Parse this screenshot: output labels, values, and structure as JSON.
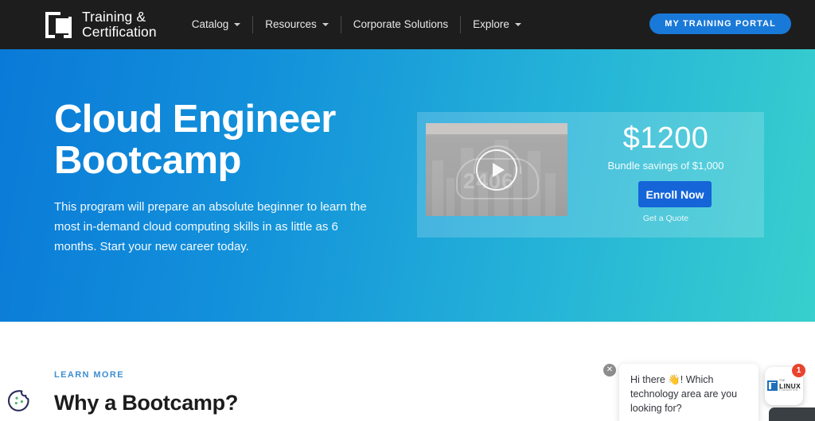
{
  "header": {
    "brand": {
      "icon": "logo-mark-icon",
      "line1": "Training &",
      "line2": "Certification"
    },
    "nav": [
      {
        "label": "Catalog",
        "has_caret": true
      },
      {
        "label": "Resources",
        "has_caret": true
      },
      {
        "label": "Corporate Solutions",
        "has_caret": false
      },
      {
        "label": "Explore",
        "has_caret": true
      }
    ],
    "portal_button": "MY TRAINING PORTAL",
    "background_color": "#1d1d1d",
    "portal_button_color": "#1979d8"
  },
  "hero": {
    "title_line1": "Cloud Engineer",
    "title_line2": "Bootcamp",
    "description": "This program will prepare an absolute beginner to learn the most in-demand cloud computing skills in as little as 6 months. Start your new career today.",
    "gradient_from": "#0a7ad8",
    "gradient_to": "#38cfcd",
    "offer": {
      "video": {
        "icon": "play-icon",
        "overlay_number": "2406"
      },
      "price": "$1200",
      "savings": "Bundle savings of $1,000",
      "enroll_label": "Enroll Now",
      "enroll_color": "#1565d8",
      "quote_label": "Get a Quote"
    }
  },
  "lower": {
    "eyebrow": "LEARN MORE",
    "eyebrow_color": "#3e8ed0",
    "title": "Why a Bootcamp?"
  },
  "cookie": {
    "icon": "cookie-icon"
  },
  "chat": {
    "close_icon": "close-icon",
    "message": "Hi there 👋! Which technology area are you looking for?",
    "avatar": {
      "icon": "linux-foundation-logo-icon",
      "the": "THE",
      "name": "LINUX",
      "foundation": "FOUNDATION"
    },
    "unread_count": "1",
    "badge_color": "#e8442e"
  }
}
